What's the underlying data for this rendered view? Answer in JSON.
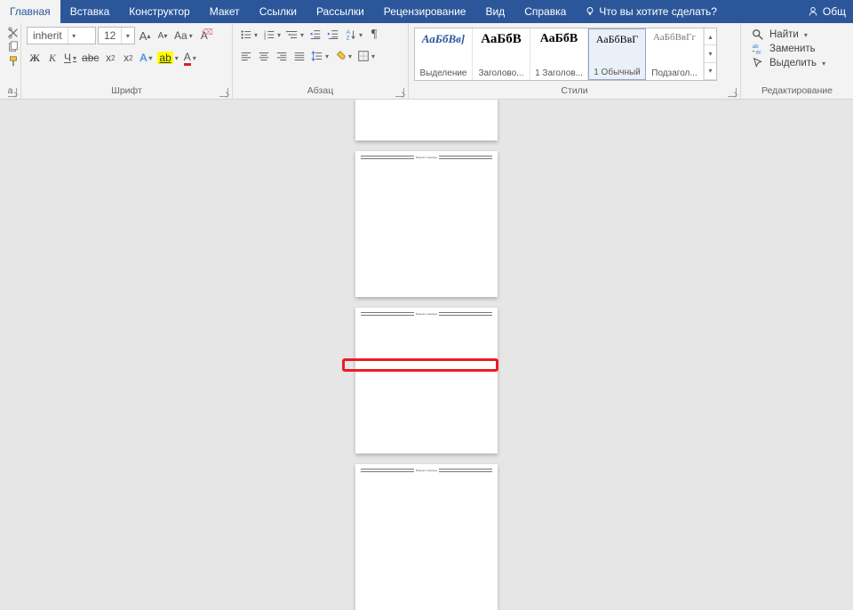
{
  "tabs": {
    "items": [
      "Главная",
      "Вставка",
      "Конструктор",
      "Макет",
      "Ссылки",
      "Рассылки",
      "Рецензирование",
      "Вид",
      "Справка"
    ],
    "active": 0,
    "tell_me": "Что вы хотите сделать?",
    "share": "Общ"
  },
  "font_group": {
    "label": "Шрифт",
    "font_name": "inherit",
    "font_size": "12",
    "bold": "Ж",
    "italic": "К",
    "underline": "Ч"
  },
  "paragraph_group": {
    "label": "Абзац"
  },
  "styles_group": {
    "label": "Стили",
    "items": [
      {
        "sample": "АаБбВв]",
        "name": "Выделение",
        "color": "#2b579a"
      },
      {
        "sample": "АаБбВ",
        "name": "Заголово...",
        "color": "#000"
      },
      {
        "sample": "АаБбВ",
        "name": "1 Заголов...",
        "color": "#000"
      },
      {
        "sample": "АаБбВвГ",
        "name": "1 Обычный",
        "color": "#000",
        "selected": true
      },
      {
        "sample": "АаБбВвГг",
        "name": "Подзагол...",
        "color": "#7a7a7a"
      }
    ]
  },
  "editing_group": {
    "label": "Редактирование",
    "find": "Найти",
    "replace": "Заменить",
    "select": "Выделить"
  },
  "page_header_label": "Разрыв страницы"
}
